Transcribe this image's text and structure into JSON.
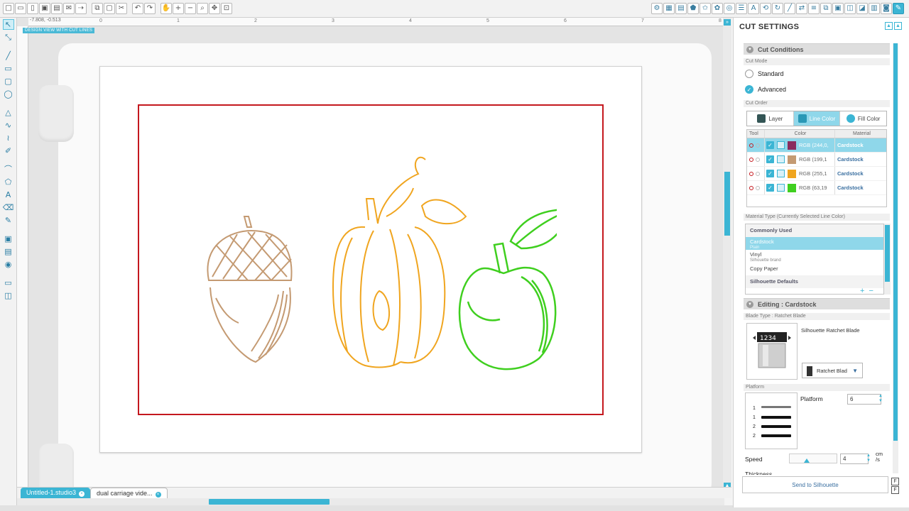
{
  "toolbar": {
    "left_icons": [
      "new-icon",
      "open-icon",
      "doc-icon",
      "save-icon",
      "save-as-icon",
      "mail-icon",
      "send-icon",
      "cut-icon",
      "copy-icon",
      "paste-icon",
      "undo-icon",
      "redo-icon",
      "pan-icon",
      "zoom-in-icon",
      "zoom-out-icon",
      "zoom-select-icon",
      "zoom-drag-icon",
      "fit-page-icon"
    ],
    "right_icons": [
      "page-setup-icon",
      "grid-icon",
      "shape-icon",
      "pentagon-icon",
      "star-icon",
      "flower-icon",
      "spiral-icon",
      "lines-icon",
      "text-icon",
      "transform-icon",
      "rotate-icon",
      "line-style-icon",
      "mirror-icon",
      "align-icon",
      "replicate-icon",
      "group-icon",
      "offset-icon",
      "trace-icon",
      "library-icon",
      "store-icon",
      "send-icon"
    ]
  },
  "left_tools": [
    "select-tool",
    "edit-points-tool",
    "line-tool",
    "rectangle-tool",
    "ellipse-tool",
    "polygon-tool",
    "curve-tool",
    "freehand-tool",
    "pen-tool",
    "knife-tool",
    "text-tool",
    "eraser-tool",
    "pencil-tool"
  ],
  "canvas": {
    "coords": "-7.808, -0.513",
    "design_label": "DESIGN VIEW WITH CUT LINES",
    "ruler_numbers": [
      "0",
      "1",
      "2",
      "3",
      "4",
      "5",
      "6",
      "7",
      "8"
    ],
    "stroke_colors": {
      "acorn": "#c49a72",
      "pumpkin": "#f0a51f",
      "apple": "#3fcf1f",
      "cut_border": "#c4181e"
    }
  },
  "tabs": [
    {
      "label": "Untitled-1.studio3",
      "active": true
    },
    {
      "label": "dual carriage vide...",
      "active": false
    }
  ],
  "panel": {
    "title": "CUT SETTINGS",
    "cut_conditions": {
      "header": "Cut Conditions",
      "cut_mode_label": "Cut Mode",
      "standard": "Standard",
      "advanced": "Advanced",
      "selected_mode": "Advanced",
      "cut_order_label": "Cut Order",
      "order_buttons": [
        "Layer",
        "Line Color",
        "Fill Color"
      ],
      "selected_order": "Line Color",
      "table_headers": {
        "tool": "Tool",
        "color": "Color",
        "material": "Material"
      },
      "rows": [
        {
          "rgb": "RGB (244,0,",
          "material": "Cardstock",
          "swatch": "#8a2c5e",
          "selected": true
        },
        {
          "rgb": "RGB (199,1",
          "material": "Cardstock",
          "swatch": "#c49a72",
          "selected": false
        },
        {
          "rgb": "RGB (255,1",
          "material": "Cardstock",
          "swatch": "#f0a51f",
          "selected": false
        },
        {
          "rgb": "RGB (63,19",
          "material": "Cardstock",
          "swatch": "#3fcf1f",
          "selected": false
        }
      ]
    },
    "material_type": {
      "label": "Material Type (Currently Selected Line Color)",
      "commonly_used": "Commonly Used",
      "items": [
        {
          "name": "Cardstock",
          "sub": "Plain",
          "selected": true
        },
        {
          "name": "Vinyl",
          "sub": "Silhouette brand",
          "selected": false
        },
        {
          "name": "Copy Paper",
          "sub": "",
          "selected": false
        }
      ],
      "defaults_header": "Silhouette Defaults"
    },
    "editing": {
      "header": "Editing : Cardstock",
      "blade_type_label": "Blade Type : Ratchet Blade",
      "blade_name": "Silhouette Ratchet Blade",
      "blade_dropdown": "Ratchet Blad",
      "platform_section": "Platform",
      "platform_label": "Platform",
      "platform_value": "6",
      "platform_levels": [
        "1",
        "1",
        "2",
        "2"
      ],
      "speed_label": "Speed",
      "speed_value": "4",
      "speed_unit_top": "cm",
      "speed_unit_bottom": "/s",
      "thickness_label": "Thickness"
    },
    "send_button": "Send to Silhouette"
  }
}
